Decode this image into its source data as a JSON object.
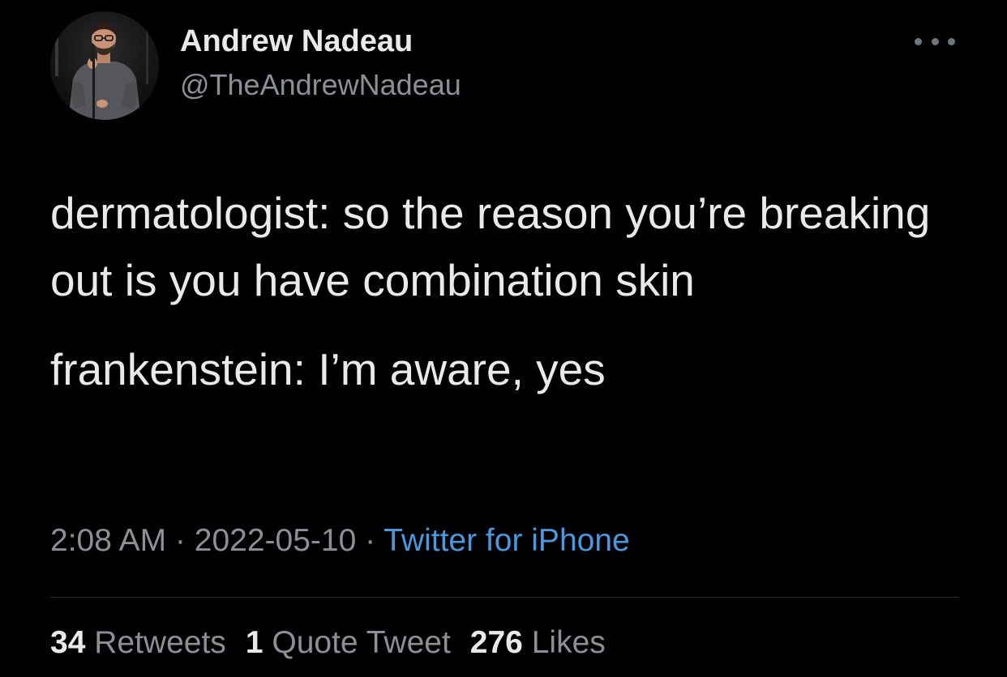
{
  "author": {
    "name": "Andrew Nadeau",
    "handle": "@TheAndrewNadeau",
    "avatar_icon": "avatar-photo"
  },
  "more_icon": "more-horizontal-icon",
  "tweet": {
    "paragraph_1": "dermatologist: so the reason you’re breaking out is you have combination skin",
    "paragraph_2": "frankenstein: I’m aware, yes"
  },
  "meta": {
    "time": "2:08 AM",
    "separator": " · ",
    "date": "2022-05-10",
    "source": "Twitter for iPhone"
  },
  "stats": {
    "retweets_count": "34",
    "retweets_label": "Retweets",
    "quotes_count": "1",
    "quotes_label": "Quote Tweet",
    "likes_count": "276",
    "likes_label": "Likes"
  },
  "colors": {
    "background": "#000000",
    "text": "#e7e9ea",
    "secondary": "#8b9096",
    "link": "#4a98e0"
  }
}
